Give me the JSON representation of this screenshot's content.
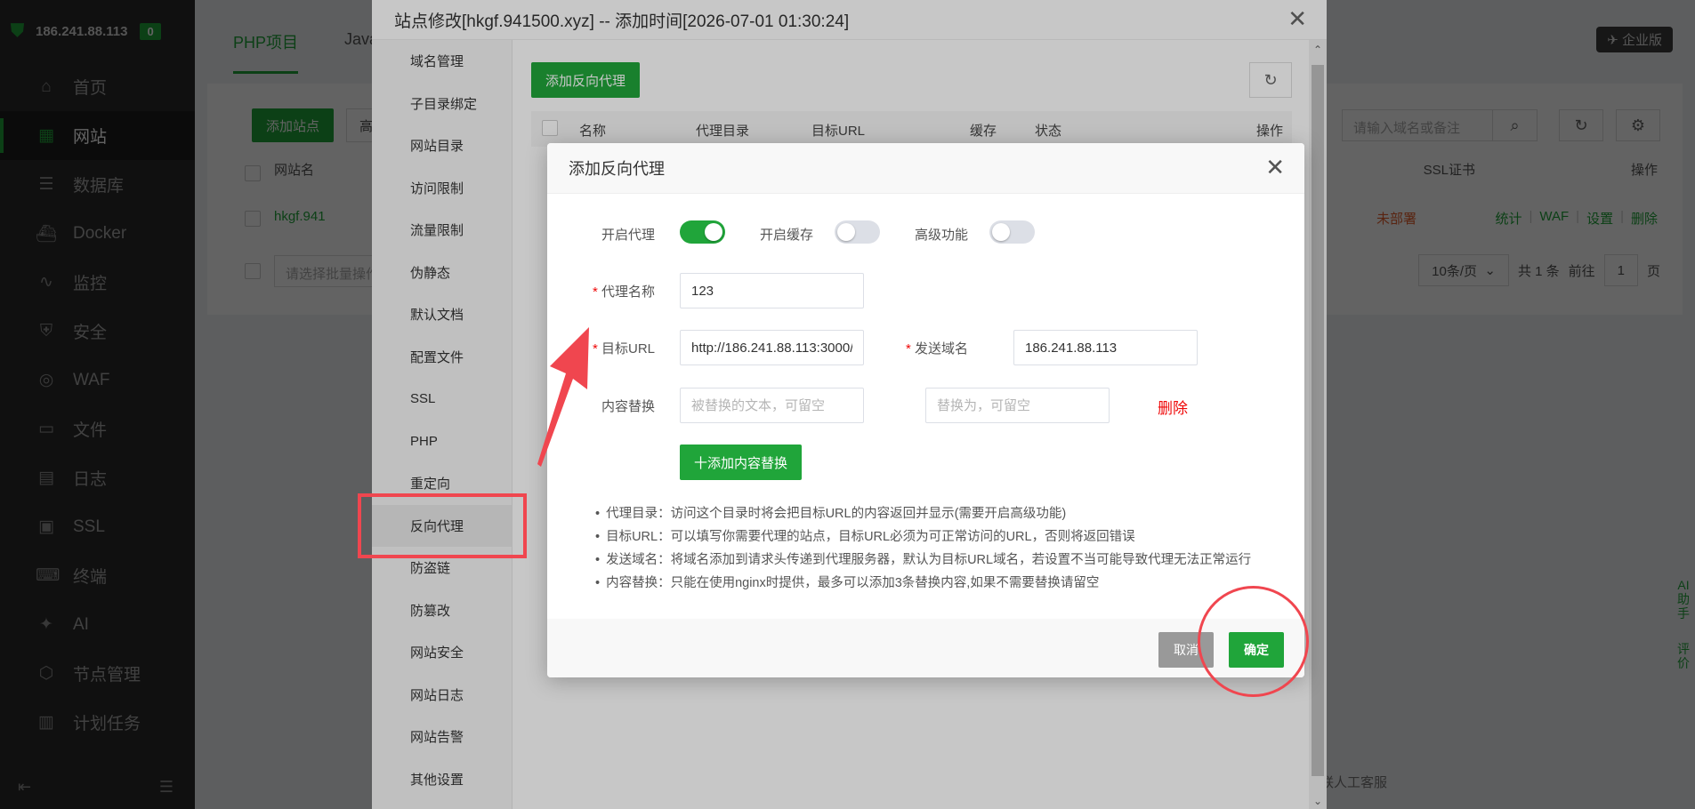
{
  "server": {
    "ip": "186.241.88.113",
    "badge": "0"
  },
  "sidebar": {
    "items": [
      {
        "label": "首页",
        "icon": "home-icon",
        "glyph": "⌂"
      },
      {
        "label": "网站",
        "icon": "website-icon",
        "glyph": "▦",
        "active": true
      },
      {
        "label": "数据库",
        "icon": "database-icon",
        "glyph": "☰"
      },
      {
        "label": "Docker",
        "icon": "docker-icon",
        "glyph": "⛴"
      },
      {
        "label": "监控",
        "icon": "monitor-icon",
        "glyph": "∿"
      },
      {
        "label": "安全",
        "icon": "security-icon",
        "glyph": "⛨"
      },
      {
        "label": "WAF",
        "icon": "waf-icon",
        "glyph": "◎"
      },
      {
        "label": "文件",
        "icon": "folder-icon",
        "glyph": "▭"
      },
      {
        "label": "日志",
        "icon": "log-icon",
        "glyph": "▤"
      },
      {
        "label": "SSL",
        "icon": "ssl-icon",
        "glyph": "▣"
      },
      {
        "label": "终端",
        "icon": "terminal-icon",
        "glyph": "⌨"
      },
      {
        "label": "AI",
        "icon": "ai-icon",
        "glyph": "✦"
      },
      {
        "label": "节点管理",
        "icon": "node-icon",
        "glyph": "⬡"
      },
      {
        "label": "计划任务",
        "icon": "calendar-icon",
        "glyph": "▥"
      }
    ]
  },
  "main": {
    "tabs": [
      "PHP项目",
      "Java"
    ],
    "enterprise": "企业版",
    "add_site": "添加站点",
    "advanced": "高级",
    "search_placeholder": "请输入域名或备注",
    "col_site": "网站名",
    "col_ssl": "SSL证书",
    "col_ops": "操作",
    "site_link": "hkgf.941",
    "ssl_status": "未部署",
    "row_ops": [
      "统计",
      "WAF",
      "设置",
      "删除"
    ],
    "batch_placeholder": "请选择批量操作",
    "page_size": "10条/页",
    "total": "共 1 条",
    "goto": "前往",
    "page_num": "1",
    "page_unit": "页",
    "service": "联人工客服",
    "ai_side": [
      "AI",
      "助",
      "手",
      "评",
      "价"
    ]
  },
  "window": {
    "title": "站点修改[hkgf.941500.xyz] -- 添加时间[2026-07-01 01:30:24]",
    "menu": [
      "域名管理",
      "子目录绑定",
      "网站目录",
      "访问限制",
      "流量限制",
      "伪静态",
      "默认文档",
      "配置文件",
      "SSL",
      "PHP",
      "重定向",
      "反向代理",
      "防盗链",
      "防篡改",
      "网站安全",
      "网站日志",
      "网站告警",
      "其他设置"
    ],
    "active_menu": "反向代理",
    "add_proxy": "添加反向代理",
    "columns": [
      "名称",
      "代理目录",
      "目标URL",
      "缓存",
      "状态",
      "操作"
    ]
  },
  "dialog": {
    "title": "添加反向代理",
    "enable_proxy_label": "开启代理",
    "enable_proxy": true,
    "enable_cache_label": "开启缓存",
    "enable_cache": false,
    "advanced_label": "高级功能",
    "advanced": false,
    "name_label": "代理名称",
    "name_value": "123",
    "target_label": "目标URL",
    "target_value": "http://186.241.88.113:3000/",
    "send_domain_label": "发送域名",
    "send_domain_value": "186.241.88.113",
    "replace_label": "内容替换",
    "replace_from_placeholder": "被替换的文本，可留空",
    "replace_to_placeholder": "替换为，可留空",
    "delete": "删除",
    "add_replace": "十添加内容替换",
    "tips": [
      "代理目录：访问这个目录时将会把目标URL的内容返回并显示(需要开启高级功能)",
      "目标URL：可以填写你需要代理的站点，目标URL必须为可正常访问的URL，否则将返回错误",
      "发送域名：将域名添加到请求头传递到代理服务器，默认为目标URL域名，若设置不当可能导致代理无法正常运行",
      "内容替换：只能在使用nginx时提供，最多可以添加3条替换内容,如果不需要替换请留空"
    ],
    "cancel": "取消",
    "confirm": "确定"
  },
  "colors": {
    "accent": "#20a53a",
    "annotation": "#f0464f",
    "required": "#ef0808"
  }
}
